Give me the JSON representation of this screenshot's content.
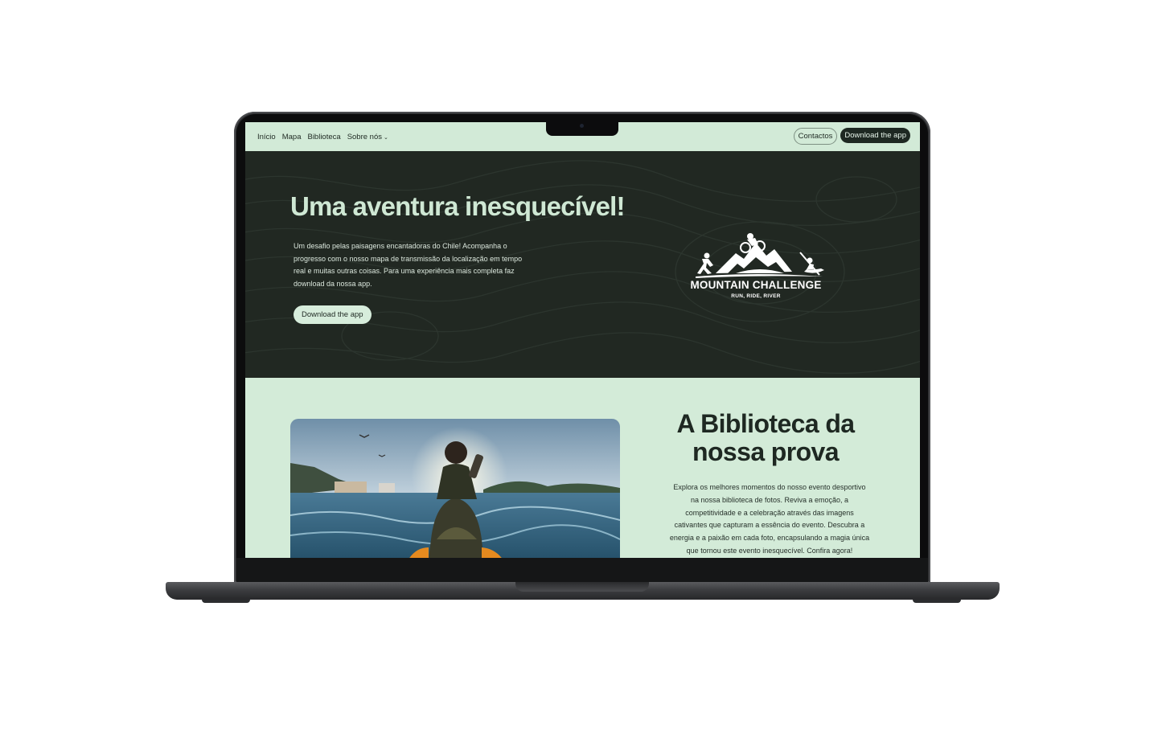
{
  "nav": {
    "links": [
      "Início",
      "Mapa",
      "Biblioteca",
      "Sobre nós"
    ],
    "dropdown_chevron": "⌄",
    "contact_label": "Contactos",
    "download_label": "Download the app"
  },
  "hero": {
    "title": "Uma aventura inesquecível!",
    "text": "Um desafio pelas paisagens encantadoras do Chile! Acompanha o progresso com o nosso mapa de transmissão da localização em tempo real e muitas outras coisas. Para uma experiência mais completa faz download da nossa app.",
    "button_label": "Download the app",
    "logo_title": "MOUNTAIN CHALLENGE",
    "logo_subtitle": "RUN, RIDE, RIVER"
  },
  "library": {
    "title": "A Biblioteca da nossa prova",
    "text": "Explora os melhores momentos do nosso evento desportivo na nossa biblioteca de fotos. Reviva a emoção, a competitividade e a celebração através das imagens cativantes que capturam a essência do evento. Descubra a energia e a paixão em cada foto, encapsulando a magia única que tornou este evento inesquecível. Confira agora!"
  },
  "colors": {
    "hero_bg": "#212822",
    "accent_mint": "#cfe8d4",
    "dark_button": "#1e2822"
  },
  "icons": [
    "mountain-challenge-logo",
    "chevron-down-icon",
    "camera-icon"
  ]
}
